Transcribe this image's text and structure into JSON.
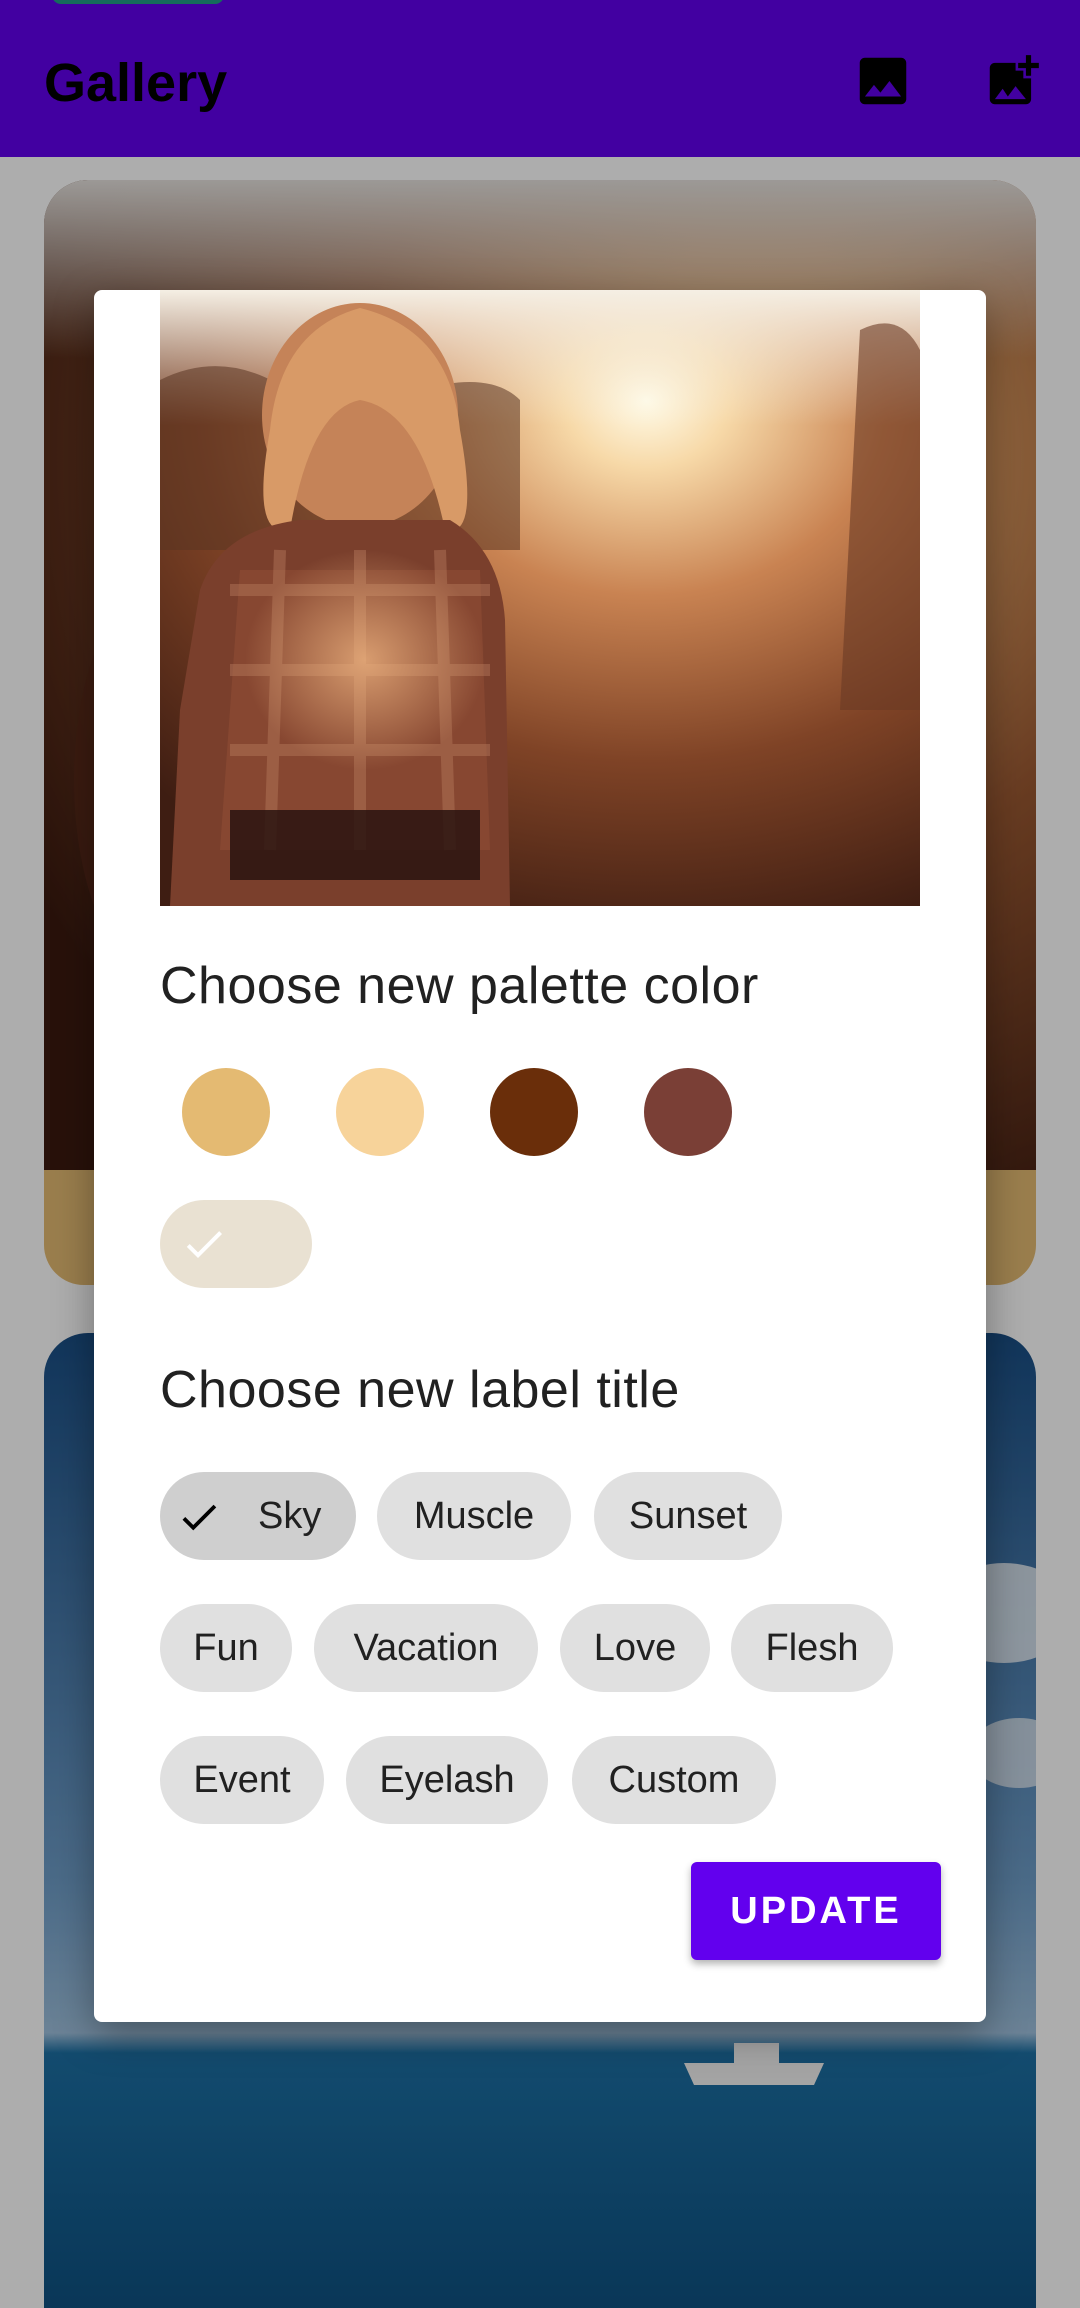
{
  "app_bar": {
    "title": "Gallery",
    "icons": [
      "image-icon",
      "add-photo-icon"
    ],
    "color": "#6200ee"
  },
  "background_cards": {
    "card_1_label_color": "#e4ba72",
    "card_2_color": "#1e5a8a"
  },
  "dialog": {
    "palette_title": "Choose new palette color",
    "palette_colors": [
      "#e4ba72",
      "#f7d39a",
      "#6a2e0a",
      "#7a3f36"
    ],
    "selected_palette_color": "#e9e1d2",
    "label_title": "Choose new label title",
    "chips": [
      {
        "label": "Sky",
        "selected": true
      },
      {
        "label": "Muscle",
        "selected": false
      },
      {
        "label": "Sunset",
        "selected": false
      },
      {
        "label": "Fun",
        "selected": false
      },
      {
        "label": "Vacation",
        "selected": false
      },
      {
        "label": "Love",
        "selected": false
      },
      {
        "label": "Flesh",
        "selected": false
      },
      {
        "label": "Event",
        "selected": false
      },
      {
        "label": "Eyelash",
        "selected": false
      },
      {
        "label": "Custom",
        "selected": false
      }
    ],
    "update_button": "UPDATE"
  }
}
